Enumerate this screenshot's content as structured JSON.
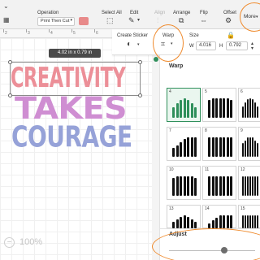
{
  "toolbar": {
    "operation_label": "Operation",
    "operation_value": "Print Then Cut",
    "operation_color": "#e88a8a",
    "select_all_label": "Select All",
    "edit_label": "Edit",
    "align_label": "Align",
    "arrange_label": "Arrange",
    "flip_label": "Flip",
    "offset_label": "Offset",
    "more_label": "More"
  },
  "subbar": {
    "create_sticker_label": "Create Sticker",
    "warp_label": "Warp",
    "size_label": "Size",
    "w_label": "W",
    "w_value": "4.016",
    "h_label": "H",
    "h_value": "0.792"
  },
  "ruler": {
    "labels": [
      "2",
      "3",
      "4",
      "5",
      "6"
    ]
  },
  "canvas": {
    "size_tooltip": "4.02 in x 0.79 in",
    "lines": [
      {
        "text": "CREATIVITY",
        "color": "#ec8f98"
      },
      {
        "text": "TAKES",
        "color": "#cf8ed2"
      },
      {
        "text": "COURAGE",
        "color": "#96a2d8"
      }
    ],
    "zoom": "100%",
    "zoom_minus": "−"
  },
  "warp_panel": {
    "title": "Warp",
    "items": [
      {
        "num": "4",
        "selected": true
      },
      {
        "num": "5",
        "selected": false
      },
      {
        "num": "6",
        "selected": false
      },
      {
        "num": "7",
        "selected": false
      },
      {
        "num": "8",
        "selected": false
      },
      {
        "num": "9",
        "selected": false
      },
      {
        "num": "10",
        "selected": false
      },
      {
        "num": "11",
        "selected": false
      },
      {
        "num": "12",
        "selected": false
      },
      {
        "num": "13",
        "selected": false
      },
      {
        "num": "14",
        "selected": false
      },
      {
        "num": "15",
        "selected": false
      }
    ],
    "adjust_label": "Adjust",
    "selected_color": "#2f8f5b"
  },
  "annotation_color": "#ef8a2c"
}
